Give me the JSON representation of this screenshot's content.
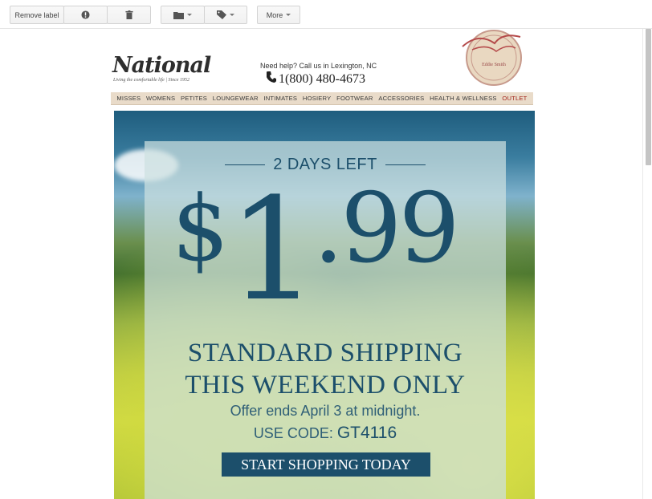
{
  "toolbar": {
    "remove_label": "Remove label",
    "report_spam_icon": "exclamation-icon",
    "delete_icon": "trash-icon",
    "move_to_icon": "folder-icon",
    "labels_icon": "tag-icon",
    "more_label": "More"
  },
  "email": {
    "brand": "National",
    "tagline": "Living the comfortable life  |  Since 1952",
    "help_text": "Need help? Call us in Lexington, NC",
    "phone": "1(800) 480-4673",
    "seal_text": "Eddie Smith",
    "nav": [
      "MISSES",
      "WOMENS",
      "PETITES",
      "LOUNGEWEAR",
      "INTIMATES",
      "HOSIERY",
      "FOOTWEAR",
      "ACCESSORIES",
      "HEALTH & WELLNESS",
      "OUTLET"
    ],
    "hero": {
      "days_left": "2 DAYS LEFT",
      "price_dollar": "$",
      "price_main": "1",
      "price_cents": ".99",
      "headline_1": "STANDARD SHIPPING",
      "headline_2": "THIS WEEKEND ONLY",
      "offer": "Offer ends April 3 at midnight.",
      "code_label": "USE CODE: ",
      "code": "GT4116",
      "cta": "START SHOPPING TODAY"
    }
  },
  "colors": {
    "brand_blue": "#1c4f6b",
    "nav_bg": "#e9dbc9",
    "outlet_red": "#a3261d"
  }
}
